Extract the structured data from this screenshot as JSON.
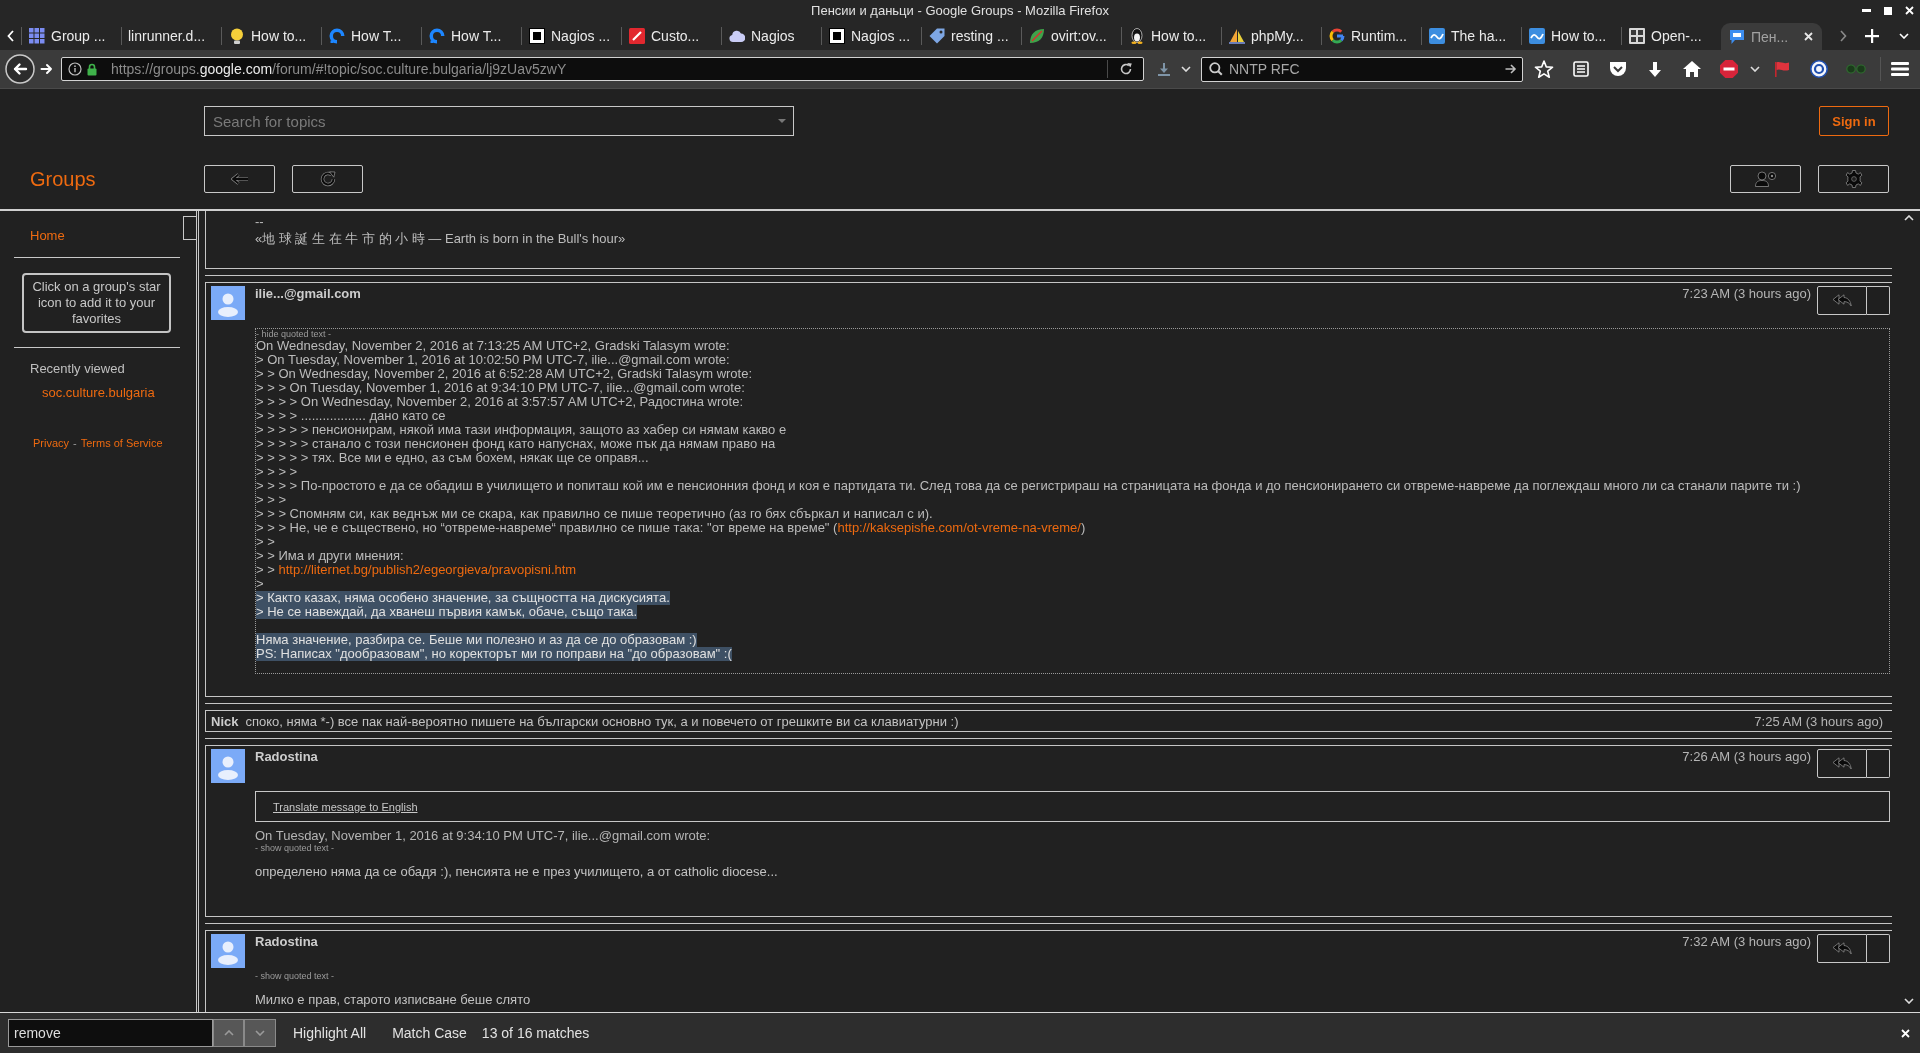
{
  "window": {
    "title": "Пенсии и даньци - Google Groups - Mozilla Firefox"
  },
  "tabs": [
    {
      "label": "Group ...",
      "kind": "grid",
      "selected": false
    },
    {
      "label": "linrunner.d...",
      "selected": false
    },
    {
      "label": "How to...",
      "kind": "bulb",
      "selected": false
    },
    {
      "label": "How T...",
      "kind": "ring",
      "selected": false
    },
    {
      "label": "How T...",
      "kind": "ring",
      "selected": false
    },
    {
      "label": "Nagios ...",
      "kind": "square",
      "selected": false
    },
    {
      "label": "Custo...",
      "kind": "slash",
      "selected": false
    },
    {
      "label": "Nagios",
      "kind": "cloud",
      "selected": false
    },
    {
      "label": "Nagios ...",
      "kind": "square",
      "selected": false
    },
    {
      "label": "resting ...",
      "kind": "tag",
      "selected": false
    },
    {
      "label": "ovirt:ov...",
      "kind": "leaf",
      "selected": false
    },
    {
      "label": "How to...",
      "kind": "penguin",
      "selected": false
    },
    {
      "label": "phpMy...",
      "kind": "sail",
      "selected": false
    },
    {
      "label": "Runtim...",
      "kind": "color-ring",
      "selected": false
    },
    {
      "label": "The ha...",
      "kind": "wave",
      "selected": false
    },
    {
      "label": "How to...",
      "kind": "wave",
      "selected": false
    },
    {
      "label": "Open-...",
      "kind": "tile",
      "selected": false
    },
    {
      "label": "Пен...",
      "kind": "bubble",
      "selected": true
    }
  ],
  "nav_bar": {
    "url": {
      "prefix": "https://groups.",
      "domain": "google.com",
      "path": "/forum/#!topic/soc.culture.bulgaria/lj9zUav5zwY"
    },
    "search": {
      "value": "NNTP RFC"
    }
  },
  "header": {
    "search": {
      "placeholder": "Search for topics"
    },
    "sign_in": "Sign in",
    "logo": "Groups"
  },
  "sidebar": {
    "items": [
      {
        "label": "Home"
      }
    ],
    "favorites_hint": "Click on a group's star icon to add it to your favorites",
    "recently_viewed": {
      "title": "Recently viewed",
      "groups": [
        "soc.culture.bulgaria"
      ]
    },
    "footer": {
      "privacy": "Privacy",
      "separator": "-",
      "terms": "Terms of Service"
    }
  },
  "messages": [
    {
      "kind": "tail",
      "lines": [
        "--",
        "«地 球 誕 生 在 牛 市 的 小 時 — Earth is born in the Bull's hour»"
      ]
    },
    {
      "kind": "full",
      "author": "ilie...@gmail.com",
      "time": "7:23 AM (3 hours ago)",
      "quote": {
        "toggle": "- hide quoted text -",
        "expanded": true,
        "paragraphs": [
          {
            "lines": [
              {
                "text": "On Wednesday, November 2, 2016 at 7:13:25 AM UTC+2, Gradski Talasym wrote:",
                "highlighted": false
              },
              {
                "text": "> On Tuesday, November 1, 2016 at 10:02:50 PM UTC-7, ilie...@gmail.com wrote:",
                "highlighted": false
              },
              {
                "text": "> > On Wednesday, November 2, 2016 at 6:52:28 AM UTC+2, Gradski Talasym wrote:",
                "highlighted": false
              },
              {
                "text": "> > > On Tuesday, November 1, 2016 at 9:34:10 PM UTC-7, ilie...@gmail.com wrote:",
                "highlighted": false
              },
              {
                "text": "> > > > On Wednesday, November 2, 2016 at 3:57:57 AM UTC+2, Радостина wrote:",
                "highlighted": false
              },
              {
                "text": "> > > > .................. дано като се",
                "highlighted": false
              },
              {
                "text": "> > > > > пенсионирам, някой има тази информация, защото аз хабер си нямам какво е",
                "highlighted": false
              },
              {
                "text": "> > > > > станало с този пенсионен фонд като напуснах, може пък да нямам право на",
                "highlighted": false
              },
              {
                "text": "> > > > > тях. Все ми е едно, аз съм бохем, някак ще се оправя...",
                "highlighted": false
              },
              {
                "text": "> > > >",
                "highlighted": false
              },
              {
                "text": "> > > > По-простото е да се обадиш в училището и попиташ кой им е пенсионния фонд и коя е партидата ти. След това да се регистрираш на страницата на фонда и до пенсионирането си отвреме-навреме да поглеждаш много ли са станали парите ти :)",
                "highlighted": false
              },
              {
                "text": "> > >",
                "highlighted": false
              },
              {
                "text": "> > > Спомням си, как веднъж ми се скара, как правилно се пише теоретично (аз го бях сбъркал и написал с и).",
                "highlighted": false
              },
              {
                "text": "> > > Не, че е съществено, но “отвреме-навреме“ правилно се пише така: \"от време на време\" (",
                "link": "http://kaksepishe.com/ot-vreme-na-vreme/",
                "tail": ")",
                "highlighted": false
              },
              {
                "text": "> >",
                "highlighted": false
              },
              {
                "text": "> > Има и други мнения:",
                "highlighted": false
              },
              {
                "text": "> > ",
                "link": "http://liternet.bg/publish2/egeorgieva/pravopisni.htm",
                "highlighted": false
              },
              {
                "text": ">",
                "highlighted": false
              },
              {
                "text": "> Както казах, няма особено значение, за същността на дискусията.",
                "highlighted": true
              },
              {
                "text": "> Не се навеждай, да хванеш първия камък, обаче, също така.",
                "highlighted": true
              }
            ]
          },
          {
            "lines": [
              {
                "text": "Няма значение, разбира се. Беше ми полезно и аз да се до образовам :)",
                "highlighted": true
              },
              {
                "text": "PS: Написах \"дообразовам\", но коректорът ми го поправи на \"до образовам\" :(",
                "highlighted": true
              }
            ]
          }
        ]
      }
    },
    {
      "kind": "compact",
      "author": "Nick",
      "snippet": "споко, няма *-) все пак най-вероятно пишете на български основно тук, а и повечето от грешките ви са клавиатурни :)",
      "time": "7:25 AM (3 hours ago)"
    },
    {
      "kind": "full",
      "author": "Radostina",
      "time": "7:26 AM (3 hours ago)",
      "translate": "Translate message to English",
      "attribution": "On Tuesday, November 1, 2016 at 9:34:10 PM UTC-7, ilie...@gmail.com wrote:",
      "quote": {
        "toggle": "- show quoted text -",
        "expanded": false
      },
      "body": [
        "определено няма да се обадя :), пенсията не е през училището, а от catholic diocese..."
      ]
    },
    {
      "kind": "full",
      "author": "Radostina",
      "time": "7:32 AM (3 hours ago)",
      "quote": {
        "toggle": "- show quoted text -",
        "expanded": false
      },
      "body": [
        "Милко е прав, старото изписване беше слято"
      ]
    }
  ],
  "find_bar": {
    "value": "remove",
    "toggles": [
      "Highlight All",
      "Match Case"
    ],
    "status": "13 of 16 matches"
  }
}
